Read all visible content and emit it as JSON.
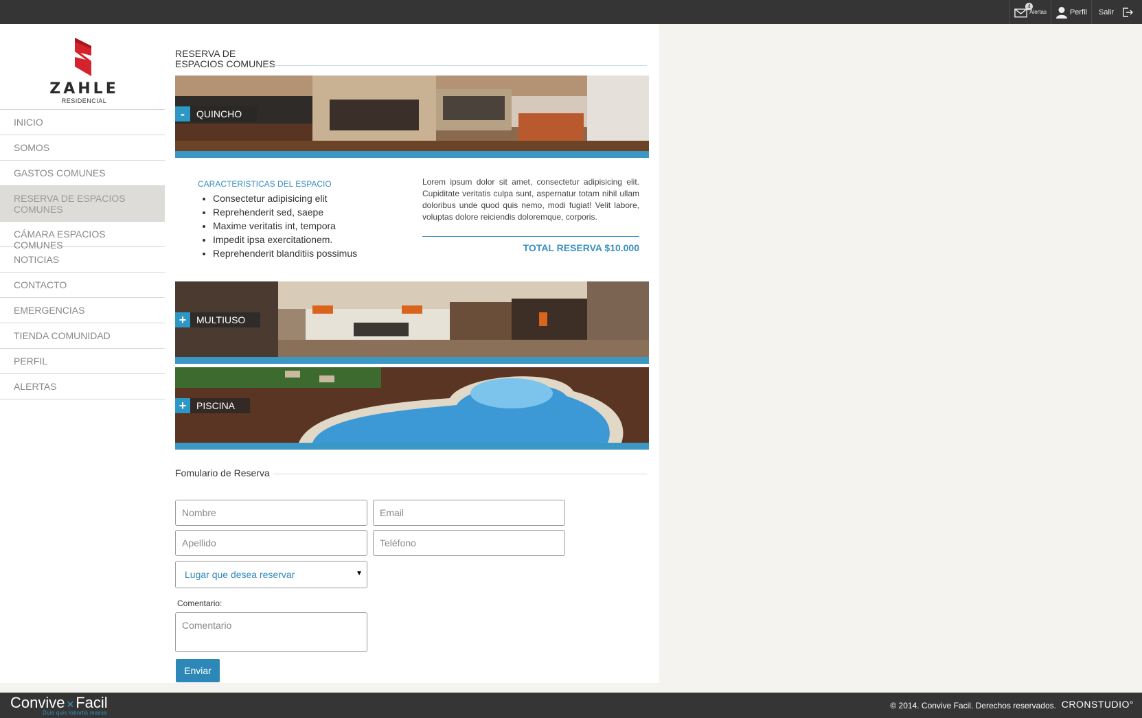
{
  "topbar": {
    "alerts_count": "4",
    "alerts_label": "Alertas",
    "profile_label": "Perfil",
    "exit_label": "Salir"
  },
  "logo": {
    "name": "ZAHLE",
    "subtitle": "RESIDENCIAL"
  },
  "nav": {
    "items": [
      {
        "label": "INICIO"
      },
      {
        "label": "SOMOS"
      },
      {
        "label": "GASTOS COMUNES"
      },
      {
        "label": "RESERVA DE ESPACIOS COMUNES",
        "active": true
      },
      {
        "label": "CÁMARA ESPACIOS COMUNES"
      },
      {
        "label": "NOTICIAS"
      },
      {
        "label": "CONTACTO"
      },
      {
        "label": "EMERGENCIAS"
      },
      {
        "label": "TIENDA COMUNIDAD"
      },
      {
        "label": "PERFIL"
      },
      {
        "label": "ALERTAS"
      }
    ]
  },
  "main": {
    "title_line1": "RESERVA DE",
    "title_line2": "ESPACIOS COMUNES",
    "spaces": [
      {
        "name": "QUINCHO",
        "toggle": "-",
        "expanded": true
      },
      {
        "name": "MULTIUSO",
        "toggle": "+"
      },
      {
        "name": "PISCINA",
        "toggle": "+"
      }
    ],
    "details": {
      "features_title": "CARACTERISTICAS DEL ESPACIO",
      "features": [
        "Consectetur adipisicing elit",
        "Reprehenderit sed, saepe",
        "Maxime veritatis int, tempora",
        "Impedit ipsa exercitationem.",
        "Reprehenderit blanditiis possimus"
      ],
      "description": "Lorem ipsum dolor sit amet, consectetur adipisicing elit. Cupiditate veritatis culpa sunt, aspernatur totam nihil ullam doloribus unde quod quis nemo, modi fugiat! Velit labore, voluptas dolore reiciendis doloremque, corporis.",
      "total": "TOTAL RESERVA $10.000"
    }
  },
  "form": {
    "title": "Fomulario de Reserva",
    "name_placeholder": "Nombre",
    "email_placeholder": "Email",
    "lastname_placeholder": "Apellido",
    "phone_placeholder": "Teléfono",
    "place_select": "Lugar que desea reservar",
    "comment_label": "Comentario:",
    "comment_placeholder": "Comentario",
    "submit_label": "Enviar"
  },
  "footer": {
    "brand_left": "Convive",
    "brand_right": "Facil",
    "tagline": "Duis quis lobortis massa",
    "copyright": "© 2014. Convive Facil. Derechos reservados.",
    "studio": "CRONSTUDIO°"
  },
  "colors": {
    "accent": "#2d98c6",
    "topbar": "#353535",
    "logo_red": "#d4232c"
  }
}
